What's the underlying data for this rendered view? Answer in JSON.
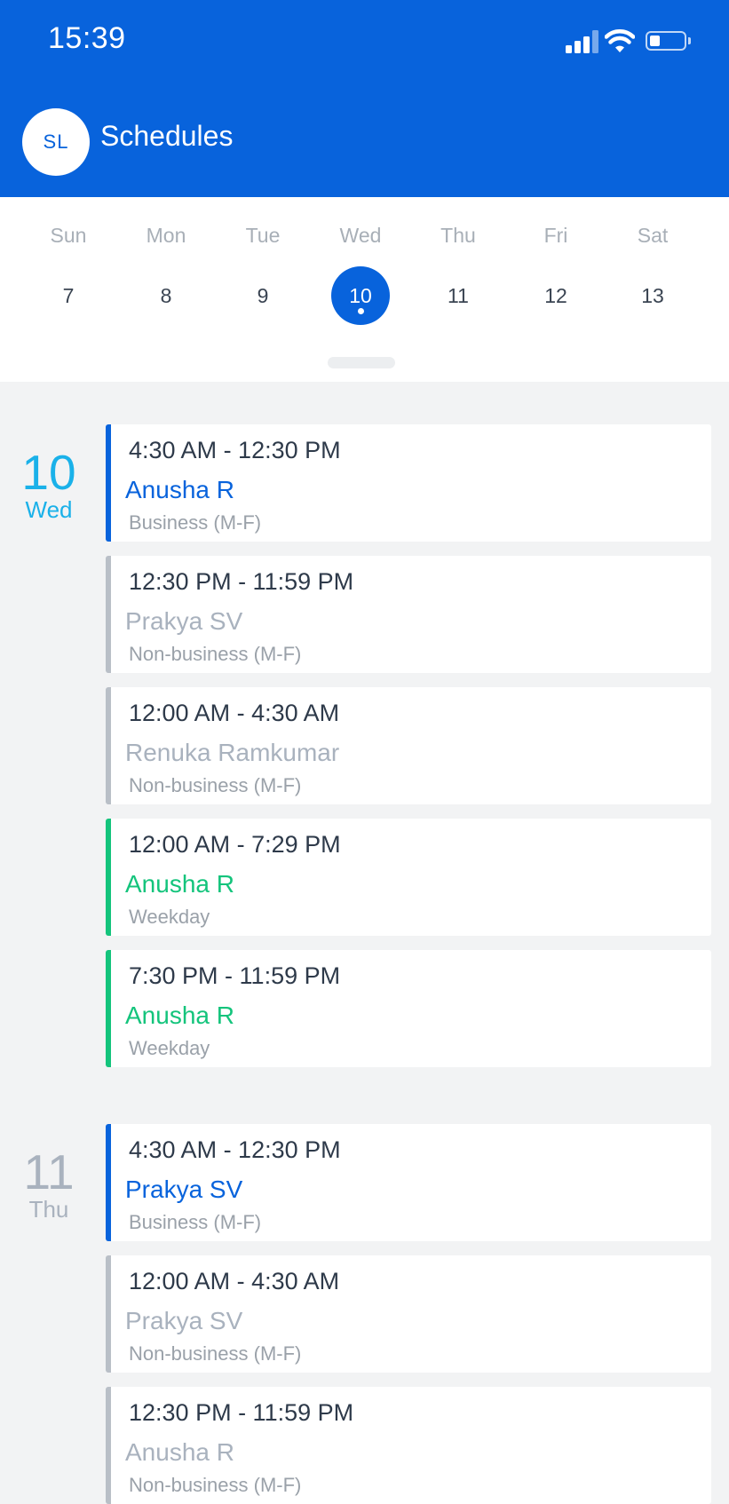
{
  "status_bar": {
    "time": "15:39",
    "battery_level": 0.3
  },
  "header": {
    "avatar_initials": "SL",
    "title": "Schedules"
  },
  "week": {
    "days": [
      {
        "name": "Sun",
        "num": "7"
      },
      {
        "name": "Mon",
        "num": "8"
      },
      {
        "name": "Tue",
        "num": "9"
      },
      {
        "name": "Wed",
        "num": "10"
      },
      {
        "name": "Thu",
        "num": "11"
      },
      {
        "name": "Fri",
        "num": "12"
      },
      {
        "name": "Sat",
        "num": "13"
      }
    ],
    "selected_day": "10"
  },
  "groups": [
    {
      "date": "10",
      "day": "Wed",
      "active": true,
      "items": [
        {
          "time": "4:30 AM - 12:30 PM",
          "name": "Anusha R",
          "layer": "Business (M-F)",
          "color": "blue"
        },
        {
          "time": "12:30 PM - 11:59 PM",
          "name": "Prakya SV",
          "layer": "Non-business (M-F)",
          "color": "gray"
        },
        {
          "time": "12:00 AM - 4:30 AM",
          "name": "Renuka Ramkumar",
          "layer": "Non-business (M-F)",
          "color": "gray"
        },
        {
          "time": "12:00 AM - 7:29 PM",
          "name": "Anusha R",
          "layer": "Weekday",
          "color": "green"
        },
        {
          "time": "7:30 PM - 11:59 PM",
          "name": "Anusha R",
          "layer": "Weekday",
          "color": "green"
        }
      ]
    },
    {
      "date": "11",
      "day": "Thu",
      "active": false,
      "items": [
        {
          "time": "4:30 AM - 12:30 PM",
          "name": "Prakya SV",
          "layer": "Business (M-F)",
          "color": "blue"
        },
        {
          "time": "12:00 AM - 4:30 AM",
          "name": "Prakya SV",
          "layer": "Non-business (M-F)",
          "color": "gray"
        },
        {
          "time": "12:30 PM - 11:59 PM",
          "name": "Anusha R",
          "layer": "Non-business (M-F)",
          "color": "gray"
        }
      ]
    }
  ],
  "colors": {
    "header_bg": "#0863dc",
    "business": "#0863dc",
    "weekday": "#14c47c",
    "non_business": "#b9bfc7",
    "active_date": "#1ab1e9"
  }
}
